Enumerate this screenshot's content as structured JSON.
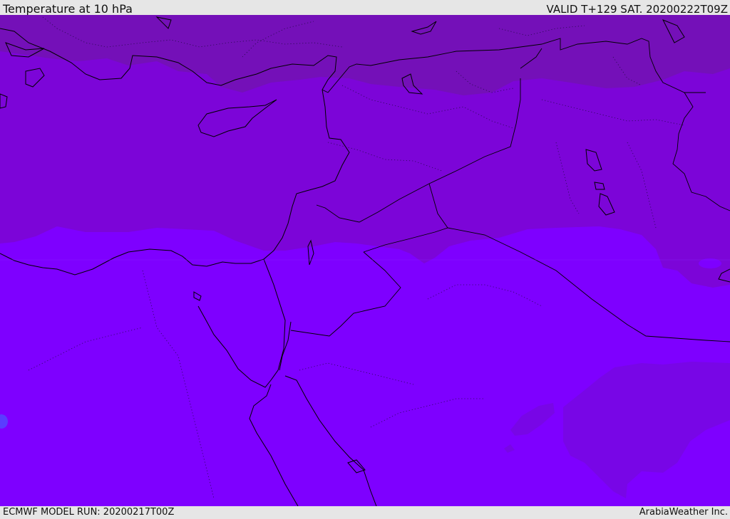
{
  "header": {
    "title": "Temperature at 10 hPa",
    "valid": "VALID T+129 SAT. 20200222T09Z"
  },
  "footer": {
    "model_run": "ECMWF MODEL RUN: 20200217T00Z",
    "credit": "ArabiaWeather Inc."
  },
  "colors": {
    "band_warm_top": "#7410b8",
    "band_upper": "#7c05d8",
    "band_lower": "#7e00ff",
    "band_patch": "#7806e6",
    "band_blue_spot": "#5a3cff",
    "coastline": "#000000",
    "frame": "#e6e6e6"
  },
  "icons": {
    "map_features": "coastlines-borders-dotted-contours"
  }
}
